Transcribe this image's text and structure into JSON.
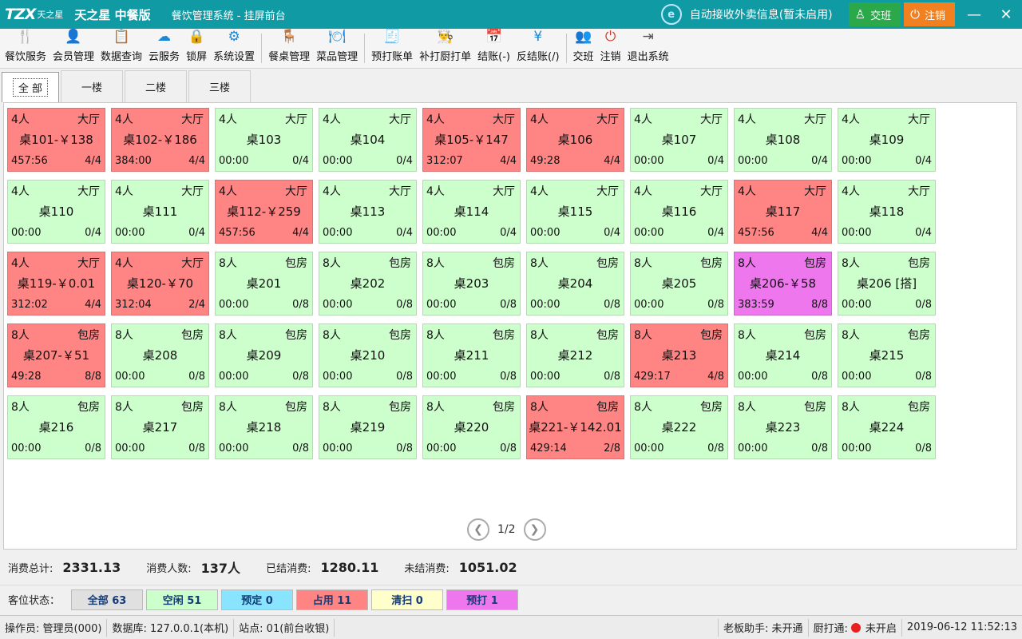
{
  "titlebar": {
    "logo_mark": "TZX",
    "logo_cn": "天之星",
    "app_name": "天之星 中餐版",
    "sys_name": "餐饮管理系统 - 挂屏前台",
    "takeout": "自动接收外卖信息(暂未启用)",
    "shift_label": "交班",
    "logout_label": "注销",
    "minimize_icon": "minimize-icon",
    "close_icon": "close-icon"
  },
  "toolbar": [
    {
      "label": "餐饮服务",
      "icon": "fork-knife-icon",
      "glyph": "🍴",
      "color": "#1a88d6"
    },
    {
      "label": "会员管理",
      "icon": "member-icon",
      "glyph": "👤",
      "color": "#1a88d6"
    },
    {
      "label": "数据查询",
      "icon": "data-query-icon",
      "glyph": "📋",
      "color": "#d23a2a"
    },
    {
      "label": "云服务",
      "icon": "cloud-icon",
      "glyph": "☁",
      "color": "#1a88d6"
    },
    {
      "label": "锁屏",
      "icon": "lock-icon",
      "glyph": "🔒",
      "color": "#1a88d6"
    },
    {
      "label": "系统设置",
      "icon": "settings-icon",
      "glyph": "⚙",
      "color": "#1a88d6"
    },
    {
      "sep": true
    },
    {
      "label": "餐桌管理",
      "icon": "table-icon",
      "glyph": "🪑",
      "color": "#1a5fb4"
    },
    {
      "label": "菜品管理",
      "icon": "dish-icon",
      "glyph": "🍽",
      "color": "#1a88d6"
    },
    {
      "sep": true
    },
    {
      "label": "预打账单",
      "icon": "bill-icon",
      "glyph": "🧾",
      "color": "#d23a2a"
    },
    {
      "label": "补打厨打单",
      "icon": "chef-icon",
      "glyph": "👨‍🍳",
      "color": "#555"
    },
    {
      "label": "结账(-)",
      "icon": "calendar-icon",
      "glyph": "📅",
      "color": "#d23a2a"
    },
    {
      "label": "反结账(/)",
      "icon": "yen-icon",
      "glyph": "¥",
      "color": "#1a88d6"
    },
    {
      "sep": true
    },
    {
      "label": "交班",
      "icon": "shift-icon",
      "glyph": "👥",
      "color": "#b0306a"
    },
    {
      "label": "注销",
      "icon": "power-icon",
      "glyph": "⏻",
      "color": "#d23a2a"
    },
    {
      "label": "退出系统",
      "icon": "exit-icon",
      "glyph": "⇥",
      "color": "#555"
    }
  ],
  "tabs": [
    "全 部",
    "一楼",
    "二楼",
    "三楼"
  ],
  "tables": [
    {
      "cap": "4人",
      "area": "大厅",
      "name": "桌101-￥138",
      "time": "457:56",
      "seat": "4/4",
      "status": "busy"
    },
    {
      "cap": "4人",
      "area": "大厅",
      "name": "桌102-￥186",
      "time": "384:00",
      "seat": "4/4",
      "status": "busy"
    },
    {
      "cap": "4人",
      "area": "大厅",
      "name": "桌103",
      "time": "00:00",
      "seat": "0/4",
      "status": "idle"
    },
    {
      "cap": "4人",
      "area": "大厅",
      "name": "桌104",
      "time": "00:00",
      "seat": "0/4",
      "status": "idle"
    },
    {
      "cap": "4人",
      "area": "大厅",
      "name": "桌105-￥147",
      "time": "312:07",
      "seat": "4/4",
      "status": "busy"
    },
    {
      "cap": "4人",
      "area": "大厅",
      "name": "桌106",
      "time": "49:28",
      "seat": "4/4",
      "status": "busy"
    },
    {
      "cap": "4人",
      "area": "大厅",
      "name": "桌107",
      "time": "00:00",
      "seat": "0/4",
      "status": "idle"
    },
    {
      "cap": "4人",
      "area": "大厅",
      "name": "桌108",
      "time": "00:00",
      "seat": "0/4",
      "status": "idle"
    },
    {
      "cap": "4人",
      "area": "大厅",
      "name": "桌109",
      "time": "00:00",
      "seat": "0/4",
      "status": "idle"
    },
    {
      "cap": "4人",
      "area": "大厅",
      "name": "桌110",
      "time": "00:00",
      "seat": "0/4",
      "status": "idle"
    },
    {
      "cap": "4人",
      "area": "大厅",
      "name": "桌111",
      "time": "00:00",
      "seat": "0/4",
      "status": "idle"
    },
    {
      "cap": "4人",
      "area": "大厅",
      "name": "桌112-￥259",
      "time": "457:56",
      "seat": "4/4",
      "status": "busy"
    },
    {
      "cap": "4人",
      "area": "大厅",
      "name": "桌113",
      "time": "00:00",
      "seat": "0/4",
      "status": "idle"
    },
    {
      "cap": "4人",
      "area": "大厅",
      "name": "桌114",
      "time": "00:00",
      "seat": "0/4",
      "status": "idle"
    },
    {
      "cap": "4人",
      "area": "大厅",
      "name": "桌115",
      "time": "00:00",
      "seat": "0/4",
      "status": "idle"
    },
    {
      "cap": "4人",
      "area": "大厅",
      "name": "桌116",
      "time": "00:00",
      "seat": "0/4",
      "status": "idle"
    },
    {
      "cap": "4人",
      "area": "大厅",
      "name": "桌117",
      "time": "457:56",
      "seat": "4/4",
      "status": "busy"
    },
    {
      "cap": "4人",
      "area": "大厅",
      "name": "桌118",
      "time": "00:00",
      "seat": "0/4",
      "status": "idle"
    },
    {
      "cap": "4人",
      "area": "大厅",
      "name": "桌119-￥0.01",
      "time": "312:02",
      "seat": "4/4",
      "status": "busy"
    },
    {
      "cap": "4人",
      "area": "大厅",
      "name": "桌120-￥70",
      "time": "312:04",
      "seat": "2/4",
      "status": "busy"
    },
    {
      "cap": "8人",
      "area": "包房",
      "name": "桌201",
      "time": "00:00",
      "seat": "0/8",
      "status": "idle"
    },
    {
      "cap": "8人",
      "area": "包房",
      "name": "桌202",
      "time": "00:00",
      "seat": "0/8",
      "status": "idle"
    },
    {
      "cap": "8人",
      "area": "包房",
      "name": "桌203",
      "time": "00:00",
      "seat": "0/8",
      "status": "idle"
    },
    {
      "cap": "8人",
      "area": "包房",
      "name": "桌204",
      "time": "00:00",
      "seat": "0/8",
      "status": "idle"
    },
    {
      "cap": "8人",
      "area": "包房",
      "name": "桌205",
      "time": "00:00",
      "seat": "0/8",
      "status": "idle"
    },
    {
      "cap": "8人",
      "area": "包房",
      "name": "桌206-￥58",
      "time": "383:59",
      "seat": "8/8",
      "status": "reserved"
    },
    {
      "cap": "8人",
      "area": "包房",
      "name": "桌206 [搭]",
      "time": "00:00",
      "seat": "0/8",
      "status": "idle"
    },
    {
      "cap": "8人",
      "area": "包房",
      "name": "桌207-￥51",
      "time": "49:28",
      "seat": "8/8",
      "status": "busy"
    },
    {
      "cap": "8人",
      "area": "包房",
      "name": "桌208",
      "time": "00:00",
      "seat": "0/8",
      "status": "idle"
    },
    {
      "cap": "8人",
      "area": "包房",
      "name": "桌209",
      "time": "00:00",
      "seat": "0/8",
      "status": "idle"
    },
    {
      "cap": "8人",
      "area": "包房",
      "name": "桌210",
      "time": "00:00",
      "seat": "0/8",
      "status": "idle"
    },
    {
      "cap": "8人",
      "area": "包房",
      "name": "桌211",
      "time": "00:00",
      "seat": "0/8",
      "status": "idle"
    },
    {
      "cap": "8人",
      "area": "包房",
      "name": "桌212",
      "time": "00:00",
      "seat": "0/8",
      "status": "idle"
    },
    {
      "cap": "8人",
      "area": "包房",
      "name": "桌213",
      "time": "429:17",
      "seat": "4/8",
      "status": "busy"
    },
    {
      "cap": "8人",
      "area": "包房",
      "name": "桌214",
      "time": "00:00",
      "seat": "0/8",
      "status": "idle"
    },
    {
      "cap": "8人",
      "area": "包房",
      "name": "桌215",
      "time": "00:00",
      "seat": "0/8",
      "status": "idle"
    },
    {
      "cap": "8人",
      "area": "包房",
      "name": "桌216",
      "time": "00:00",
      "seat": "0/8",
      "status": "idle"
    },
    {
      "cap": "8人",
      "area": "包房",
      "name": "桌217",
      "time": "00:00",
      "seat": "0/8",
      "status": "idle"
    },
    {
      "cap": "8人",
      "area": "包房",
      "name": "桌218",
      "time": "00:00",
      "seat": "0/8",
      "status": "idle"
    },
    {
      "cap": "8人",
      "area": "包房",
      "name": "桌219",
      "time": "00:00",
      "seat": "0/8",
      "status": "idle"
    },
    {
      "cap": "8人",
      "area": "包房",
      "name": "桌220",
      "time": "00:00",
      "seat": "0/8",
      "status": "idle"
    },
    {
      "cap": "8人",
      "area": "包房",
      "name": "桌221-￥142.01",
      "time": "429:14",
      "seat": "2/8",
      "status": "busy"
    },
    {
      "cap": "8人",
      "area": "包房",
      "name": "桌222",
      "time": "00:00",
      "seat": "0/8",
      "status": "idle"
    },
    {
      "cap": "8人",
      "area": "包房",
      "name": "桌223",
      "time": "00:00",
      "seat": "0/8",
      "status": "idle"
    },
    {
      "cap": "8人",
      "area": "包房",
      "name": "桌224",
      "time": "00:00",
      "seat": "0/8",
      "status": "idle"
    }
  ],
  "pager": {
    "text": "1/2",
    "prev_icon": "chevron-left-icon",
    "next_icon": "chevron-right-icon"
  },
  "summary": {
    "total_label": "消费总计:",
    "total_value": "2331.13",
    "people_label": "消费人数:",
    "people_value": "137人",
    "settled_label": "已结消费:",
    "settled_value": "1280.11",
    "unsettled_label": "未结消费:",
    "unsettled_value": "1051.02"
  },
  "status_filter": {
    "label": "客位状态：",
    "buttons": [
      {
        "label": "全部 63",
        "cls": "all"
      },
      {
        "label": "空闲 51",
        "cls": "idle"
      },
      {
        "label": "预定 0",
        "cls": "booked"
      },
      {
        "label": "占用 11",
        "cls": "busy"
      },
      {
        "label": "清扫 0",
        "cls": "clean"
      },
      {
        "label": "预打 1",
        "cls": "pre"
      }
    ]
  },
  "footer": {
    "operator": "操作员:  管理员(000)",
    "database": "数据库: 127.0.0.1(本机)",
    "station": "站点: 01(前台收银)",
    "boss": "老板助手: 未开通",
    "kitchen_label": "厨打通:",
    "kitchen_status": "未开启",
    "datetime": "2019-06-12 11:52:13"
  },
  "colors": {
    "titlebar": "#0f9aa4",
    "idle": "#ccffcc",
    "busy": "#ff8585",
    "reserved": "#ee77ee"
  }
}
